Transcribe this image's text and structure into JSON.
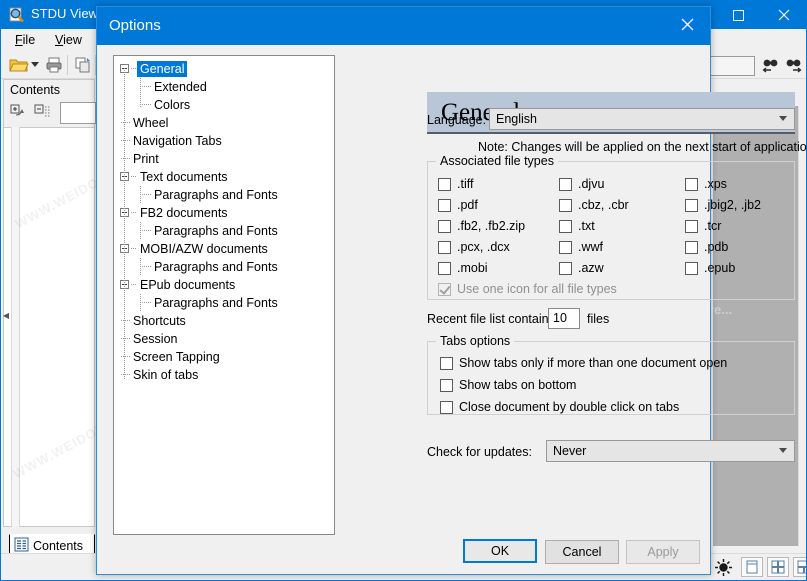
{
  "app": {
    "title": "STDU Viewer",
    "icon": "magnifier-document-icon",
    "menus": [
      {
        "label": "File",
        "accel": "F"
      },
      {
        "label": "View",
        "accel": "V"
      }
    ],
    "toolbar": [
      {
        "name": "open-file-icon",
        "label": "Open"
      },
      {
        "name": "open-dropdown-icon",
        "label": "Open dropdown"
      },
      {
        "name": "print-icon",
        "label": "Print"
      },
      {
        "name": "copy-icon",
        "label": "Copy"
      }
    ],
    "sidebar": {
      "tab_label": "Contents",
      "tab_icon": "contents-document-icon",
      "tools": [
        {
          "name": "expand-all-icon",
          "label": "Expand all"
        },
        {
          "name": "collapse-all-icon",
          "label": "Collapse all"
        }
      ]
    },
    "find": {
      "value": "",
      "prev_icon": "find-previous-icon",
      "next_icon": "find-next-icon"
    },
    "statusbar": {
      "brightness_icon": "brightness-icon",
      "view_modes": [
        {
          "name": "single-page-view-icon"
        },
        {
          "name": "continuous-facing-view-icon"
        },
        {
          "name": "facing-pages-view-icon"
        }
      ]
    },
    "window_buttons": [
      {
        "name": "maximize-button",
        "glyph": "maximize"
      },
      {
        "name": "close-button",
        "glyph": "close"
      }
    ],
    "watermarks": [
      "WWW.WEIDOWN.COM",
      "WWW.WEIDOWN.COM",
      "re..."
    ]
  },
  "dialog": {
    "title": "Options",
    "close_icon": "close-icon",
    "tree": [
      {
        "label": "General",
        "depth": 0,
        "expander": "minus",
        "selected": true
      },
      {
        "label": "Extended",
        "depth": 1,
        "expander": "none",
        "selected": false
      },
      {
        "label": "Colors",
        "depth": 1,
        "expander": "none",
        "selected": false
      },
      {
        "label": "Wheel",
        "depth": 0,
        "expander": "none",
        "selected": false
      },
      {
        "label": "Navigation Tabs",
        "depth": 0,
        "expander": "none",
        "selected": false
      },
      {
        "label": "Print",
        "depth": 0,
        "expander": "none",
        "selected": false
      },
      {
        "label": "Text documents",
        "depth": 0,
        "expander": "minus",
        "selected": false
      },
      {
        "label": "Paragraphs and Fonts",
        "depth": 1,
        "expander": "none",
        "selected": false
      },
      {
        "label": "FB2 documents",
        "depth": 0,
        "expander": "minus",
        "selected": false
      },
      {
        "label": "Paragraphs and Fonts",
        "depth": 1,
        "expander": "none",
        "selected": false
      },
      {
        "label": "MOBI/AZW documents",
        "depth": 0,
        "expander": "minus",
        "selected": false
      },
      {
        "label": "Paragraphs and Fonts",
        "depth": 1,
        "expander": "none",
        "selected": false
      },
      {
        "label": "EPub documents",
        "depth": 0,
        "expander": "minus",
        "selected": false
      },
      {
        "label": "Paragraphs and Fonts",
        "depth": 1,
        "expander": "none",
        "selected": false
      },
      {
        "label": "Shortcuts",
        "depth": 0,
        "expander": "none",
        "selected": false
      },
      {
        "label": "Session",
        "depth": 0,
        "expander": "none",
        "selected": false
      },
      {
        "label": "Screen Tapping",
        "depth": 0,
        "expander": "none",
        "selected": false
      },
      {
        "label": "Skin of tabs",
        "depth": 0,
        "expander": "none",
        "selected": false
      }
    ],
    "pane": {
      "heading": "General",
      "language_label": "Language:",
      "language_value": "English",
      "note": "Note: Changes will be applied on the next start of application",
      "file_types": {
        "title": "Associated file types",
        "items": [
          {
            "label": ".tiff",
            "checked": false,
            "disabled": false,
            "col": 0,
            "row": 0
          },
          {
            "label": ".pdf",
            "checked": false,
            "disabled": false,
            "col": 0,
            "row": 1
          },
          {
            "label": ".fb2, .fb2.zip",
            "checked": false,
            "disabled": false,
            "col": 0,
            "row": 2
          },
          {
            "label": ".pcx, .dcx",
            "checked": false,
            "disabled": false,
            "col": 0,
            "row": 3
          },
          {
            "label": ".mobi",
            "checked": false,
            "disabled": false,
            "col": 0,
            "row": 4
          },
          {
            "label": ".djvu",
            "checked": false,
            "disabled": false,
            "col": 1,
            "row": 0
          },
          {
            "label": ".cbz, .cbr",
            "checked": false,
            "disabled": false,
            "col": 1,
            "row": 1
          },
          {
            "label": ".txt",
            "checked": false,
            "disabled": false,
            "col": 1,
            "row": 2
          },
          {
            "label": ".wwf",
            "checked": false,
            "disabled": false,
            "col": 1,
            "row": 3
          },
          {
            "label": ".azw",
            "checked": false,
            "disabled": false,
            "col": 1,
            "row": 4
          },
          {
            "label": ".xps",
            "checked": false,
            "disabled": false,
            "col": 2,
            "row": 0
          },
          {
            "label": ".jbig2, .jb2",
            "checked": false,
            "disabled": false,
            "col": 2,
            "row": 1
          },
          {
            "label": ".tcr",
            "checked": false,
            "disabled": false,
            "col": 2,
            "row": 2
          },
          {
            "label": ".pdb",
            "checked": false,
            "disabled": false,
            "col": 2,
            "row": 3
          },
          {
            "label": ".epub",
            "checked": false,
            "disabled": false,
            "col": 2,
            "row": 4
          }
        ],
        "one_icon": {
          "label": "Use one icon for all file types",
          "checked": true,
          "disabled": true
        }
      },
      "recent": {
        "prefix": "Recent file list contains:",
        "value": "10",
        "suffix": "files"
      },
      "tabs_options": {
        "title": "Tabs options",
        "items": [
          {
            "label": "Show tabs only if more than one document open",
            "checked": false
          },
          {
            "label": "Show tabs on bottom",
            "checked": false
          },
          {
            "label": "Close document by double click on tabs",
            "checked": false
          }
        ]
      },
      "updates": {
        "label": "Check for updates:",
        "value": "Never"
      }
    },
    "buttons": {
      "ok": "OK",
      "cancel": "Cancel",
      "apply": "Apply"
    }
  },
  "colors": {
    "accent": "#0078d7",
    "pane_header_bg": "#b8c6d8",
    "dialog_bg": "#f0f0f0",
    "doc_area": "#b0b0b0"
  }
}
